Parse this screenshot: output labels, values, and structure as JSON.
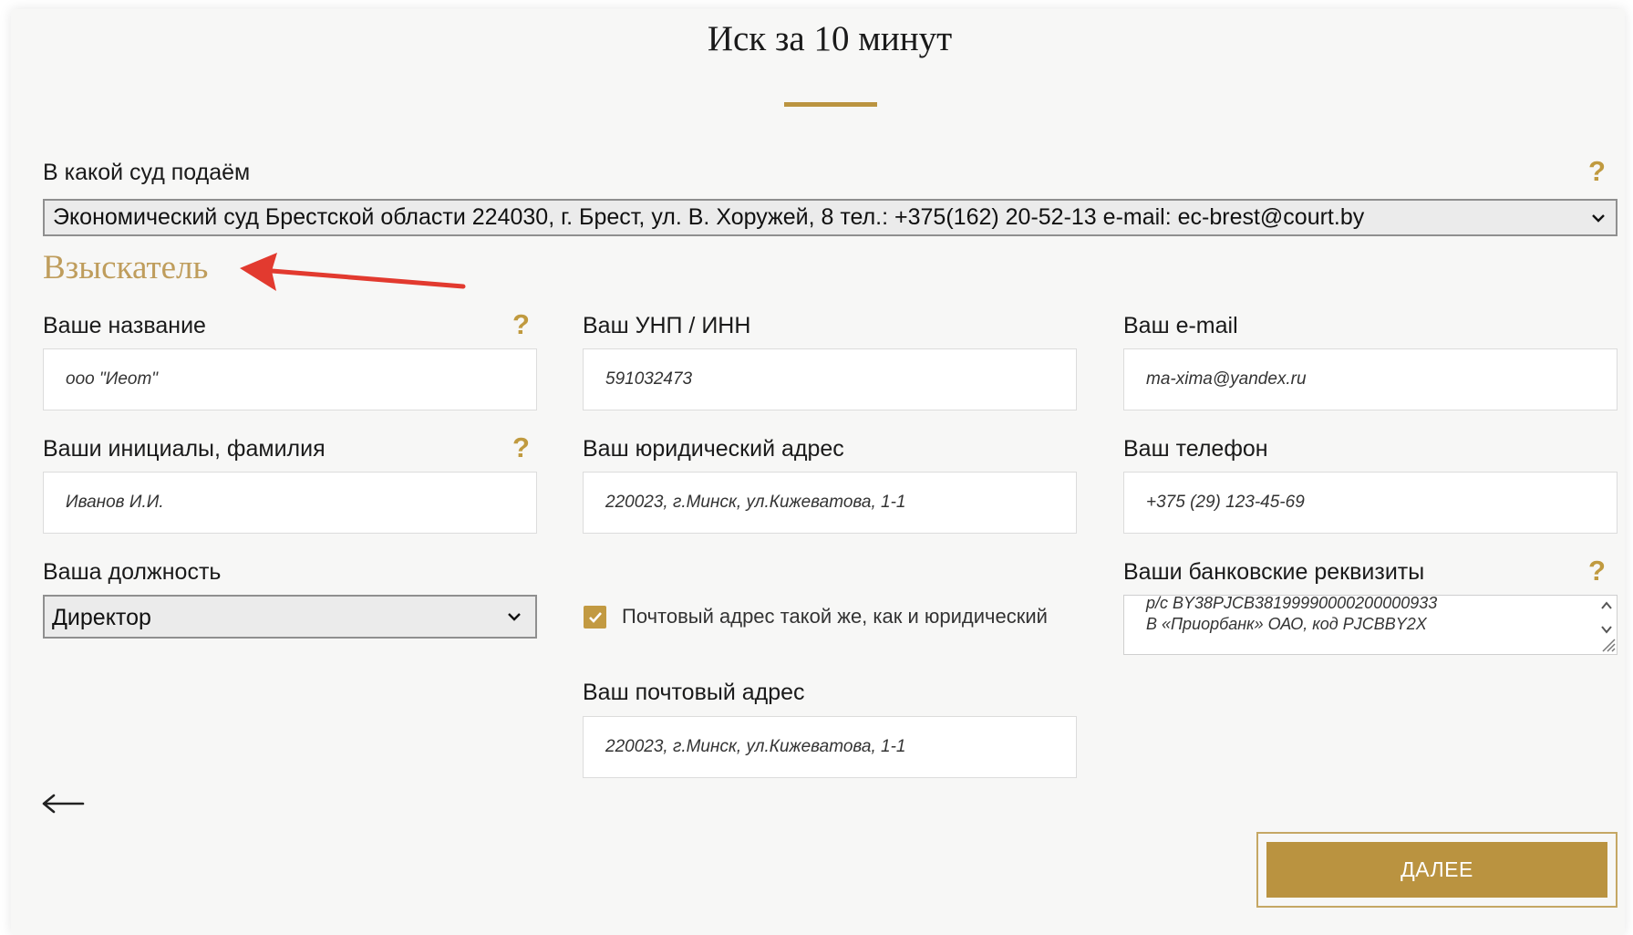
{
  "page": {
    "title": "Иск за 10 минут"
  },
  "court": {
    "label": "В какой суд подаём",
    "selected": "Экономический суд Брестской области 224030, г. Брест, ул. В. Хоружей, 8 тел.: +375(162) 20-52-13 e-mail: ec-brest@court.by"
  },
  "section": {
    "title": "Взыскатель"
  },
  "fields": {
    "name": {
      "label": "Ваше название",
      "value": "ооо \"Иеот\""
    },
    "unp": {
      "label": "Ваш УНП / ИНН",
      "value": "591032473"
    },
    "email": {
      "label": "Ваш e-mail",
      "value": "ma-xima@yandex.ru"
    },
    "initials": {
      "label": "Ваши инициалы, фамилия",
      "value": "Иванов И.И."
    },
    "legal_address": {
      "label": "Ваш юридический адрес",
      "value": "220023, г.Минск, ул.Кижеватова, 1-1"
    },
    "phone": {
      "label": "Ваш телефон",
      "value": "+375 (29) 123-45-69"
    },
    "position": {
      "label": "Ваша должность",
      "selected": "Директор"
    },
    "bank": {
      "label": "Ваши банковские реквизиты",
      "line1": "р/с BY38PJCB38199990000200000933",
      "line2": "В «Приорбанк» ОАО, код PJCBBY2X"
    },
    "postal_same": {
      "label": "Почтовый адрес такой же, как и юридический",
      "checked": true
    },
    "postal_address": {
      "label": "Ваш почтовый адрес",
      "value": "220023, г.Минск, ул.Кижеватова, 1-1"
    }
  },
  "help_mark": "?",
  "buttons": {
    "next": "ДАЛЕЕ"
  },
  "colors": {
    "accent": "#ba9340",
    "section_title": "#bf9d5c",
    "annotation_arrow": "#e23a2f"
  },
  "icons": {
    "back": "arrow-left-icon",
    "dropdown": "chevron-down-icon",
    "checkbox": "check-icon"
  }
}
